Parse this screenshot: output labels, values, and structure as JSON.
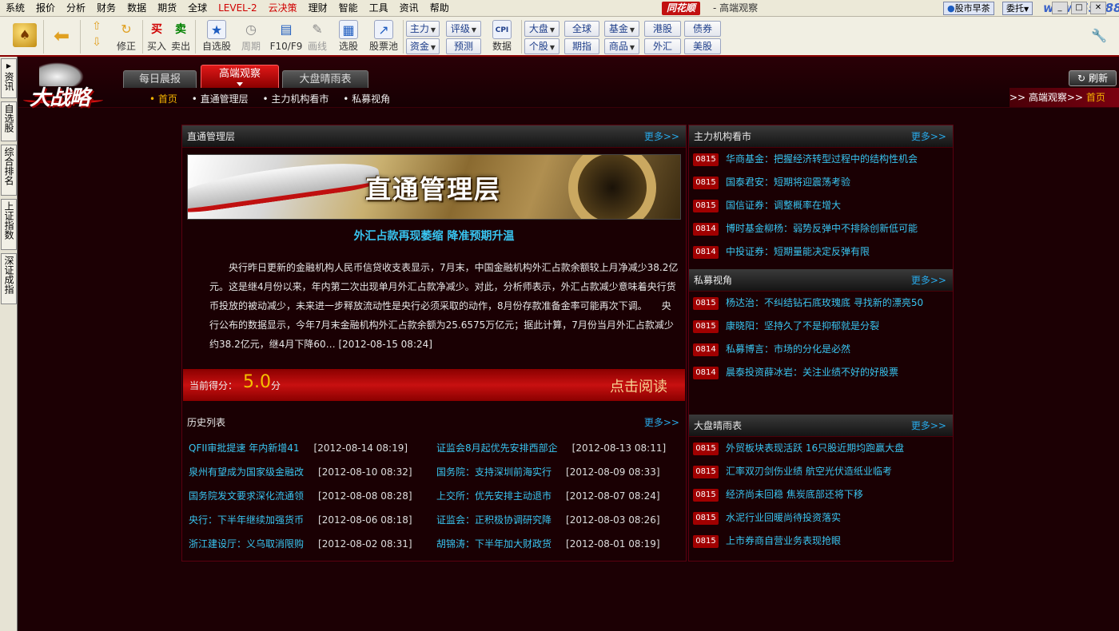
{
  "menu": {
    "items": [
      "系统",
      "报价",
      "分析",
      "财务",
      "数据",
      "期货",
      "全球",
      "LEVEL-2",
      "云决策",
      "理财",
      "智能",
      "工具",
      "资讯",
      "帮助"
    ],
    "red_items": [
      "LEVEL-2",
      "云决策"
    ],
    "brand": "同花顺",
    "window_title": "- 高端观察",
    "right_btn1": "股市早茶",
    "right_btn2": "委托",
    "watermark": "www.55188.com"
  },
  "toolbar": {
    "revise": "修正",
    "buy_icon": "买",
    "sell_icon": "卖",
    "buy": "买入",
    "sell": "卖出",
    "watchlist": "自选股",
    "period": "周期",
    "f10": "F10/F9",
    "draw": "画线",
    "select": "选股",
    "pool": "股票池",
    "data": "数据",
    "cpi": "CPI",
    "btn_zhuli": "主力",
    "btn_zijin": "资金",
    "btn_pingji": "评级",
    "btn_yuce": "预测",
    "btn_dapan": "大盘",
    "btn_gegu": "个股",
    "btn_quanqiu": "全球",
    "btn_qizhi": "期指",
    "btn_jijin": "基金",
    "btn_shangpin": "商品",
    "btn_ganggu": "港股",
    "btn_waihui": "外汇",
    "btn_zhaiquan": "债券",
    "btn_meigu": "美股"
  },
  "left_tabs": [
    "资讯",
    "自选股",
    "综合排名",
    "上证指数",
    "深证成指"
  ],
  "header": {
    "logo_text": "大战略",
    "tabs": [
      "每日晨报",
      "高端观察",
      "大盘晴雨表"
    ],
    "active_tab": "高端观察",
    "subnav": [
      "• 首页",
      "• 直通管理层",
      "• 主力机构看市",
      "• 私募视角"
    ],
    "refresh": "刷新",
    "crumb_prefix": ">> 高端观察>>",
    "crumb_current": "首页"
  },
  "main": {
    "title": "直通管理层",
    "more": "更多>>",
    "banner_text": "直通管理层",
    "article_title": "外汇占款再现萎缩 降准预期升温",
    "article_body": "央行昨日更新的金融机构人民币信贷收支表显示，7月末，中国金融机构外汇占款余额较上月净减少38.2亿元。这是继4月份以来，年内第二次出现单月外汇占款净减少。对此，分析师表示，外汇占款减少意味着央行货币投放的被动减少，未来进一步释放流动性是央行必须采取的动作，8月份存款准备金率可能再次下调。　　央行公布的数据显示，今年7月末金融机构外汇占款余额为25.6575万亿元；据此计算，7月份当月外汇占款减少约38.2亿元，继4月下降60… [2012-08-15 08:24]",
    "score_label": "当前得分：",
    "score_value": "5.0",
    "score_unit": "分",
    "read_button": "点击阅读",
    "history_title": "历史列表",
    "history": [
      {
        "title": "QFII审批提速 年内新增41",
        "date": "[2012-08-14 08:19]"
      },
      {
        "title": "证监会8月起优先安排西部企",
        "date": "[2012-08-13 08:11]"
      },
      {
        "title": "泉州有望成为国家级金融改",
        "date": "[2012-08-10 08:32]"
      },
      {
        "title": "国务院：支持深圳前海实行",
        "date": "[2012-08-09 08:33]"
      },
      {
        "title": "国务院发文要求深化流通领",
        "date": "[2012-08-08 08:28]"
      },
      {
        "title": "上交所：优先安排主动退市",
        "date": "[2012-08-07 08:24]"
      },
      {
        "title": "央行：下半年继续加强货币",
        "date": "[2012-08-06 08:18]"
      },
      {
        "title": "证监会：正积极协调研究降",
        "date": "[2012-08-03 08:26]"
      },
      {
        "title": "浙江建设厅：义乌取消限购",
        "date": "[2012-08-02 08:31]"
      },
      {
        "title": "胡锦涛：下半年加大财政货",
        "date": "[2012-08-01 08:19]"
      }
    ]
  },
  "right": {
    "sections": [
      {
        "title": "主力机构看市",
        "more": "更多>>",
        "items": [
          {
            "date": "0815",
            "text": "华商基金：把握经济转型过程中的结构性机会"
          },
          {
            "date": "0815",
            "text": "国泰君安：短期将迎震荡考验"
          },
          {
            "date": "0815",
            "text": "国信证券：调整概率在增大"
          },
          {
            "date": "0814",
            "text": "博时基金柳杨：弱势反弹中不排除创新低可能"
          },
          {
            "date": "0814",
            "text": "中投证券：短期量能决定反弹有限"
          }
        ]
      },
      {
        "title": "私募视角",
        "more": "更多>>",
        "items": [
          {
            "date": "0815",
            "text": "杨达治：不纠结钻石底玫瑰底 寻找新的漂亮50"
          },
          {
            "date": "0815",
            "text": "康晓阳：坚持久了不是抑郁就是分裂"
          },
          {
            "date": "0814",
            "text": "私募博言：市场的分化是必然"
          },
          {
            "date": "0814",
            "text": "晨泰投资薛冰岩：关注业绩不好的好股票"
          }
        ]
      },
      {
        "title": "大盘晴雨表",
        "more": "更多>>",
        "items": [
          {
            "date": "0815",
            "text": "外贸板块表现活跃 16只股近期均跑赢大盘"
          },
          {
            "date": "0815",
            "text": "汇率双刃剑伤业绩 航空光伏造纸业临考"
          },
          {
            "date": "0815",
            "text": "经济尚未回稳 焦炭底部还将下移"
          },
          {
            "date": "0815",
            "text": "水泥行业回暖尚待投资落实"
          },
          {
            "date": "0815",
            "text": "上市券商自营业务表现抢眼"
          }
        ]
      }
    ]
  }
}
